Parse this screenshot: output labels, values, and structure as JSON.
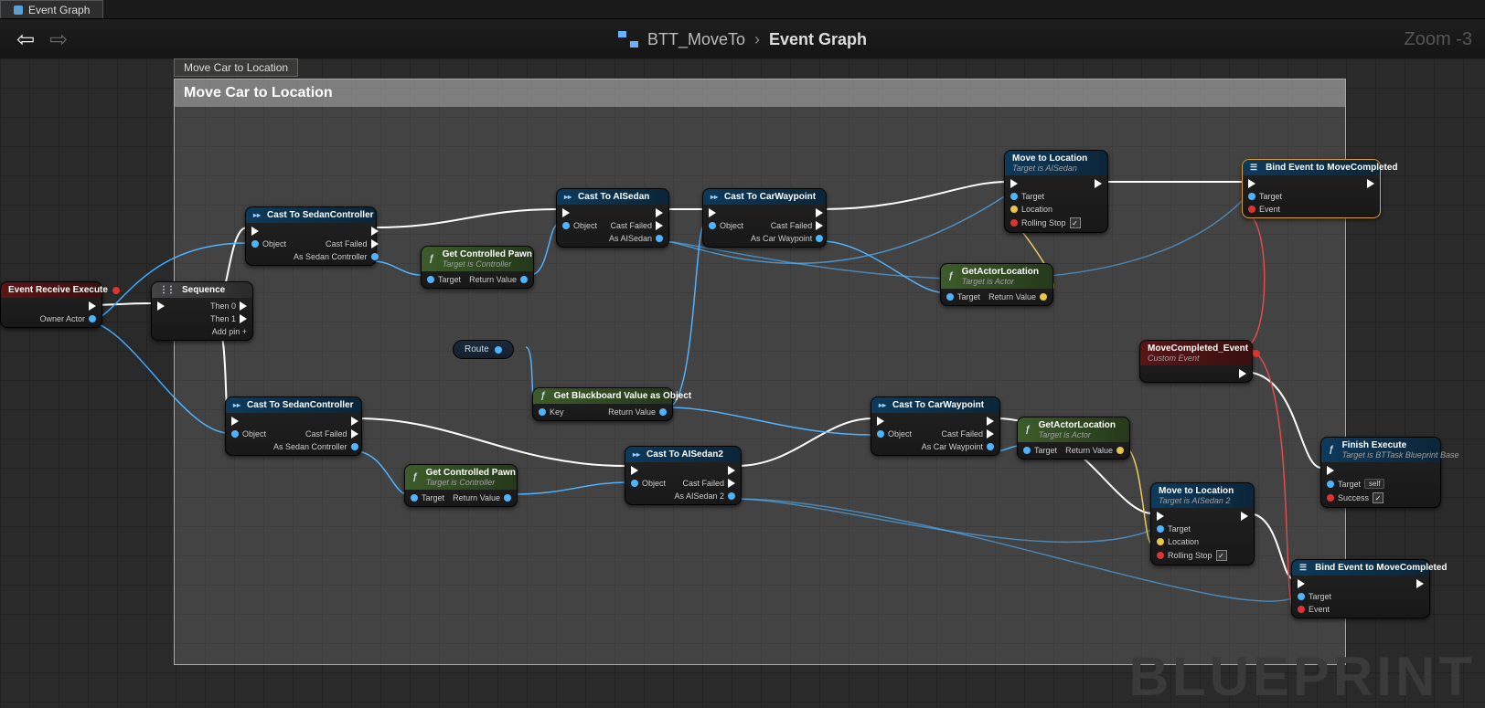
{
  "tab": {
    "label": "Event Graph"
  },
  "toolbar": {
    "back": "←",
    "fwd": "→"
  },
  "breadcrumb": {
    "a": "BTT_MoveTo",
    "sep": "›",
    "b": "Event Graph"
  },
  "zoom": "Zoom -3",
  "watermark": "BLUEPRINT",
  "comment": {
    "tooltip": "Move Car to Location",
    "title": "Move Car to Location"
  },
  "pins": {
    "exec": "",
    "object": "Object",
    "target": "Target",
    "return": "Return Value",
    "castfailed": "Cast Failed",
    "owner": "Owner Actor",
    "key": "Key",
    "then0": "Then 0",
    "then1": "Then 1",
    "addpin": "Add pin  +",
    "as_sedan_ctrl": "As Sedan Controller",
    "as_aisedan": "As AISedan",
    "as_aisedan2": "As AISedan 2",
    "as_carwp": "As Car Waypoint",
    "location": "Location",
    "rolling": "Rolling Stop",
    "event": "Event",
    "success": "Success",
    "self": "self",
    "route": "Route"
  },
  "nodes": {
    "receive": {
      "title": "Event Receive Execute"
    },
    "seq": {
      "title": "Sequence"
    },
    "cast_sedan1": {
      "title": "Cast To SedanController"
    },
    "cast_sedan2": {
      "title": "Cast To SedanController"
    },
    "pawn1": {
      "title": "Get Controlled Pawn",
      "sub": "Target is Controller"
    },
    "pawn2": {
      "title": "Get Controlled Pawn",
      "sub": "Target is Controller"
    },
    "cast_ai1": {
      "title": "Cast To AISedan"
    },
    "cast_ai2": {
      "title": "Cast To AISedan2"
    },
    "cast_wp1": {
      "title": "Cast To CarWaypoint"
    },
    "cast_wp2": {
      "title": "Cast To CarWaypoint"
    },
    "bb": {
      "title": "Get Blackboard Value as Object"
    },
    "actorloc1": {
      "title": "GetActorLocation",
      "sub": "Target is Actor"
    },
    "actorloc2": {
      "title": "GetActorLocation",
      "sub": "Target is Actor"
    },
    "move1": {
      "title": "Move to Location",
      "sub": "Target is AISedan"
    },
    "move2": {
      "title": "Move to Location",
      "sub": "Target is AISedan 2"
    },
    "bind1": {
      "title": "Bind Event to MoveCompleted"
    },
    "bind2": {
      "title": "Bind Event to MoveCompleted"
    },
    "mcevent": {
      "title": "MoveCompleted_Event",
      "sub": "Custom Event"
    },
    "finish": {
      "title": "Finish Execute",
      "sub": "Target is BTTask Blueprint Base"
    }
  }
}
